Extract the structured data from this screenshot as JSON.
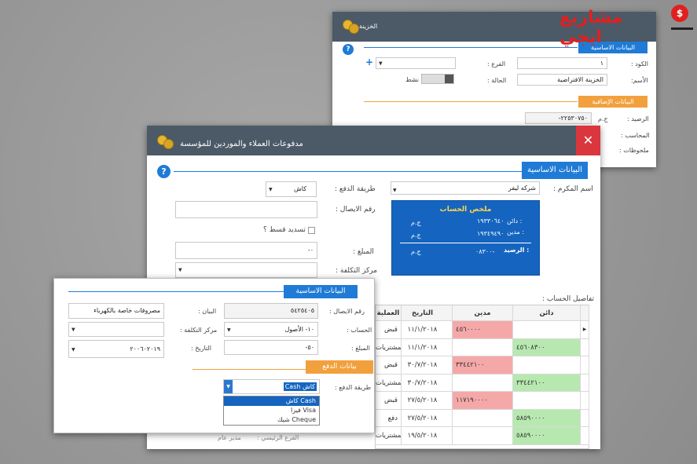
{
  "logo": {
    "text": "مشاريع ايجي"
  },
  "back": {
    "title": "الخزينة",
    "basic": "البيانات الاساسية",
    "extra": "البيانات الإضافية",
    "code_l": "الكود :",
    "code_v": "١",
    "branch_l": "الفرع :",
    "name_l": "الأسم:",
    "name_v": "الخزينة الافتراضية",
    "status_l": "الحالة :",
    "status_v": "نشط",
    "bal_l": "الرصيد :",
    "bal_v": "٢٢٥٣٠٧٥٠-",
    "cur": "ج.م",
    "acct_l": "المحاسب :",
    "notes_l": "ملحوظات :",
    "plus": "+"
  },
  "main": {
    "title": "مدفوعات العملاء والموردين للمؤسسة",
    "close": "✕",
    "basic": "البيانات الاساسية",
    "person_l": "اسم المكرم :",
    "person_v": "شركه ليفر",
    "pay_l": "طريقة الدفع :",
    "pay_v": "كاش",
    "receipt_l": "رقم الايصال :",
    "install_l": "تسديد قسط ؟",
    "amount_l": "المبلغ :",
    "amount_v": "٠-",
    "cost_l": "مركز التكلفة :",
    "summary": {
      "title": "ملخص الحساب",
      "credit_l": "دائن :",
      "credit_v": "١٩٣٣٠٦٤٠",
      "debit_l": "مدين :",
      "debit_v": "١٩٣٤٩٤٩٠",
      "bal_l": "الرصيد :",
      "bal_v": "٠٨٣٠٠-",
      "cur": "ج.م"
    },
    "details_l": "تفاصيل الحساب :",
    "grid": {
      "headers": [
        "دائن",
        "مدين",
        "التاريخ",
        "العملية"
      ],
      "rows": [
        {
          "credit": "",
          "debit": "٤٥٦٠٠٠٠",
          "date": "١١/١/٢٠١٨",
          "op": "قبض"
        },
        {
          "credit": "٤٥٦٠٨٣٠٠",
          "debit": "",
          "date": "١١/١/٢٠١٨",
          "op": "المشتريات"
        },
        {
          "credit": "",
          "debit": "٣٣٤٤٢١٠٠",
          "date": "٣٠/٧/٢٠١٨",
          "op": "قبض"
        },
        {
          "credit": "٣٣٤٤٢١٠٠",
          "debit": "",
          "date": "٣٠/٧/٢٠١٨",
          "op": "المشتريات"
        },
        {
          "credit": "",
          "debit": "١١٧١٩٠٠٠٠",
          "date": "٢٧/٥/٢٠١٨",
          "op": "قبض"
        },
        {
          "credit": "٥٨٥٩٠٠٠٠",
          "debit": "",
          "date": "٢٧/٥/٢٠١٨",
          "op": "دفع"
        },
        {
          "credit": "٥٨٥٩٠٠٠٠",
          "debit": "",
          "date": "١٩/٥/٢٠١٨",
          "op": "المشتريات"
        }
      ]
    },
    "footer": {
      "a": "الفرع الرئيسي :",
      "b": "مدير عام"
    }
  },
  "front": {
    "basic": "البيانات الاساسية",
    "pay_sec": "بيانات الدفع",
    "receipt_l": "رقم الايصال :",
    "receipt_v": "٥٤٢٥٤٠٥",
    "stmt_l": "البيان :",
    "stmt_v": "مصروفات خاصة بالكهرباء",
    "acct_l": "الحساب :",
    "acct_v": "١٠- الأصول",
    "cost_l": "مركز التكلفة :",
    "amount_l": "المبلغ :",
    "amount_v": "٥٠-",
    "date_l": "التاريخ :",
    "date_v": "٢٠٠٦٠٢٠١٩",
    "method_l": "طريقة الدفع :",
    "method_v": "كاش Cash",
    "options": [
      "كاش Cash",
      "فيزا Visa",
      "شيك Cheque"
    ]
  }
}
